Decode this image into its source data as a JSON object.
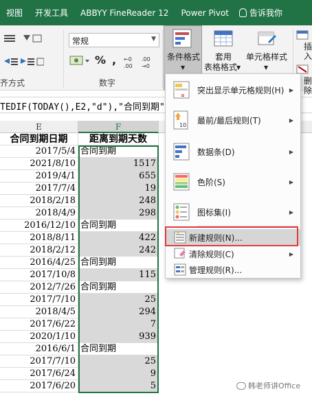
{
  "tabs": [
    "视图",
    "开发工具",
    "ABBYY FineReader 12",
    "Power Pivot",
    "告诉我你"
  ],
  "ribbon": {
    "number_format_value": "常规",
    "group_align_label": "齐方式",
    "group_number_label": "数字",
    "percent_symbol": "%",
    "comma_symbol": ",",
    "cond_format_label": "条件格式",
    "table_format_label_1": "套用",
    "table_format_label_2": "表格格式",
    "cell_style_label": "单元格样式",
    "insert_label": "插入",
    "delete_label": "删除"
  },
  "formula_bar": "TEDIF(TODAY(),E2,\"d\"),\"合同到期\")",
  "columns": {
    "e": "E",
    "f": "F"
  },
  "header_row": {
    "e": "合同到期日期",
    "f": "距离到期天数"
  },
  "rows": [
    {
      "e": "2017/5/4",
      "f": "合同到期",
      "t": "text"
    },
    {
      "e": "2021/8/10",
      "f": "1517",
      "t": "num"
    },
    {
      "e": "2019/4/1",
      "f": "655",
      "t": "num"
    },
    {
      "e": "2017/7/4",
      "f": "19",
      "t": "num"
    },
    {
      "e": "2018/2/18",
      "f": "248",
      "t": "num"
    },
    {
      "e": "2018/4/9",
      "f": "298",
      "t": "num"
    },
    {
      "e": "2016/12/10",
      "f": "合同到期",
      "t": "text"
    },
    {
      "e": "2018/8/11",
      "f": "422",
      "t": "num"
    },
    {
      "e": "2018/2/12",
      "f": "242",
      "t": "num"
    },
    {
      "e": "2016/4/25",
      "f": "合同到期",
      "t": "text"
    },
    {
      "e": "2017/10/8",
      "f": "115",
      "t": "num"
    },
    {
      "e": "2012/7/26",
      "f": "合同到期",
      "t": "text"
    },
    {
      "e": "2017/7/10",
      "f": "25",
      "t": "num"
    },
    {
      "e": "2018/4/5",
      "f": "294",
      "t": "num"
    },
    {
      "e": "2017/6/22",
      "f": "7",
      "t": "num"
    },
    {
      "e": "2020/1/10",
      "f": "939",
      "t": "num"
    },
    {
      "e": "2016/6/1",
      "f": "合同到期",
      "t": "text"
    },
    {
      "e": "2017/7/10",
      "f": "25",
      "t": "num"
    },
    {
      "e": "2017/6/24",
      "f": "9",
      "t": "num"
    },
    {
      "e": "2017/6/20",
      "f": "5",
      "t": "num"
    }
  ],
  "menu": {
    "items": [
      {
        "label": "突出显示单元格规则(H)",
        "icon": "highlight-cells-icon",
        "arrow": true
      },
      {
        "label": "最前/最后规则(T)",
        "icon": "top-bottom-icon",
        "arrow": true
      },
      {
        "label": "数据条(D)",
        "icon": "data-bars-icon",
        "arrow": true
      },
      {
        "label": "色阶(S)",
        "icon": "color-scales-icon",
        "arrow": true
      },
      {
        "label": "图标集(I)",
        "icon": "icon-sets-icon",
        "arrow": true
      },
      {
        "label": "新建规则(N)...",
        "icon": "new-rule-icon",
        "arrow": false
      },
      {
        "label": "清除规则(C)",
        "icon": "clear-rules-icon",
        "arrow": true
      },
      {
        "label": "管理规则(R)...",
        "icon": "manage-rules-icon",
        "arrow": false
      }
    ],
    "icon_text_1": "≤",
    "icon_text_2": "10"
  },
  "watermark": "韩老师讲Office",
  "colors": {
    "excel_green": "#217346",
    "highlight_red": "#e03a3a",
    "selection_gray": "#d9d9d9"
  }
}
